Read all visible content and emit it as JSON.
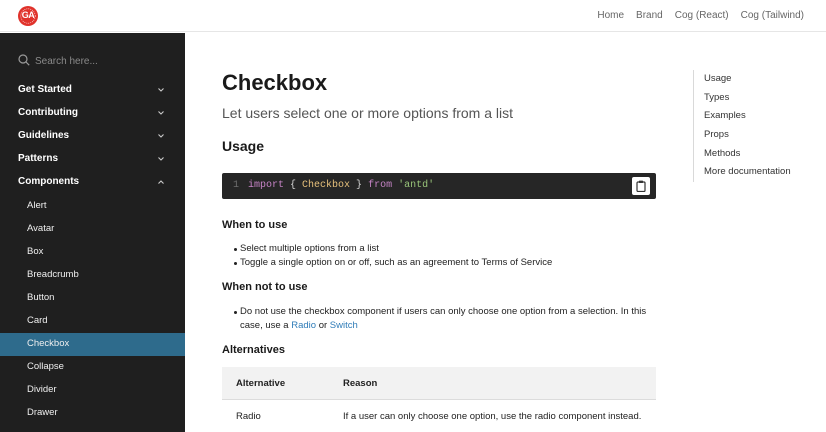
{
  "header": {
    "logo_text": "GA",
    "nav": [
      "Home",
      "Brand",
      "Cog (React)",
      "Cog (Tailwind)"
    ]
  },
  "sidebar": {
    "search_placeholder": "Search here...",
    "sections": [
      {
        "label": "Get Started",
        "expanded": false
      },
      {
        "label": "Contributing",
        "expanded": false
      },
      {
        "label": "Guidelines",
        "expanded": false
      },
      {
        "label": "Patterns",
        "expanded": false
      },
      {
        "label": "Components",
        "expanded": true
      }
    ],
    "components": [
      "Alert",
      "Avatar",
      "Box",
      "Breadcrumb",
      "Button",
      "Card",
      "Checkbox",
      "Collapse",
      "Divider",
      "Drawer"
    ],
    "active_item": "Checkbox",
    "active_color": "#2e6b8c"
  },
  "main": {
    "title": "Checkbox",
    "subtitle": "Let users select one or more options from a list",
    "usage_heading": "Usage",
    "code": {
      "line_number": "1",
      "kw_import": "import",
      "brace_open": " { ",
      "class_name": "Checkbox",
      "brace_close": " } ",
      "kw_from": "from",
      "module": " 'antd'"
    },
    "when_to_use_heading": "When to use",
    "when_to_use": [
      "Select multiple options from a list",
      "Toggle a single option on or off, such as an agreement to Terms of Service"
    ],
    "when_not_heading": "When not to use",
    "when_not_line1": "Do not use the checkbox component if users can only choose one option from a selection. In this",
    "when_not_line2_prefix": "case, use a ",
    "when_not_link1": "Radio",
    "when_not_or": " or ",
    "when_not_link2": "Switch",
    "alternatives_heading": "Alternatives",
    "table": {
      "headers": [
        "Alternative",
        "Reason"
      ],
      "rows": [
        {
          "alternative": "Radio",
          "reason": "If a user can only choose one option, use the radio component instead."
        }
      ]
    }
  },
  "toc": [
    "Usage",
    "Types",
    "Examples",
    "Props",
    "Methods",
    "More documentation"
  ]
}
